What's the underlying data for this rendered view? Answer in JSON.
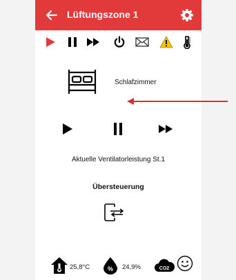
{
  "header": {
    "title": "Lüftungszone 1"
  },
  "toolbar": {
    "icons": [
      "play-icon",
      "pause-icon",
      "fast-forward-icon",
      "power-icon",
      "mail-icon",
      "warning-icon",
      "thermometer-icon"
    ]
  },
  "room": {
    "label": "Schlafzimmer",
    "icon": "bed-icon"
  },
  "controls": {
    "icons": [
      "play-icon",
      "pause-icon",
      "fast-forward-icon"
    ]
  },
  "status": {
    "text": "Aktuelle Ventilatorleistung St.1"
  },
  "override": {
    "label": "Übersteuerung",
    "icon": "override-toggle-icon"
  },
  "sensors": {
    "temperature": "25,8°C",
    "humidity": "24,9%",
    "co2_label": "CO2"
  },
  "colors": {
    "accent": "#e23a3a",
    "warning": "#f2c500"
  }
}
